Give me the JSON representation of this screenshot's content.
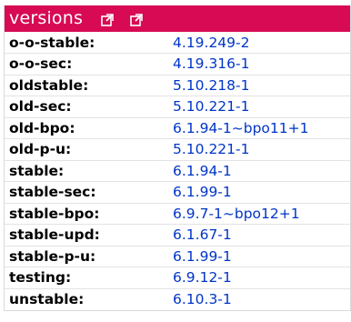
{
  "header": {
    "title": "versions",
    "icons": [
      "external-link-icon",
      "external-link-icon"
    ]
  },
  "colors": {
    "header_bg": "#d70a53",
    "link": "#0035c7"
  },
  "rows": [
    {
      "label": "o-o-stable:",
      "version": "4.19.249-2"
    },
    {
      "label": "o-o-sec:",
      "version": "4.19.316-1"
    },
    {
      "label": "oldstable:",
      "version": "5.10.218-1"
    },
    {
      "label": "old-sec:",
      "version": "5.10.221-1"
    },
    {
      "label": "old-bpo:",
      "version": "6.1.94-1~bpo11+1"
    },
    {
      "label": "old-p-u:",
      "version": "5.10.221-1"
    },
    {
      "label": "stable:",
      "version": "6.1.94-1"
    },
    {
      "label": "stable-sec:",
      "version": "6.1.99-1"
    },
    {
      "label": "stable-bpo:",
      "version": "6.9.7-1~bpo12+1"
    },
    {
      "label": "stable-upd:",
      "version": "6.1.67-1"
    },
    {
      "label": "stable-p-u:",
      "version": "6.1.99-1"
    },
    {
      "label": "testing:",
      "version": "6.9.12-1"
    },
    {
      "label": "unstable:",
      "version": "6.10.3-1"
    }
  ]
}
